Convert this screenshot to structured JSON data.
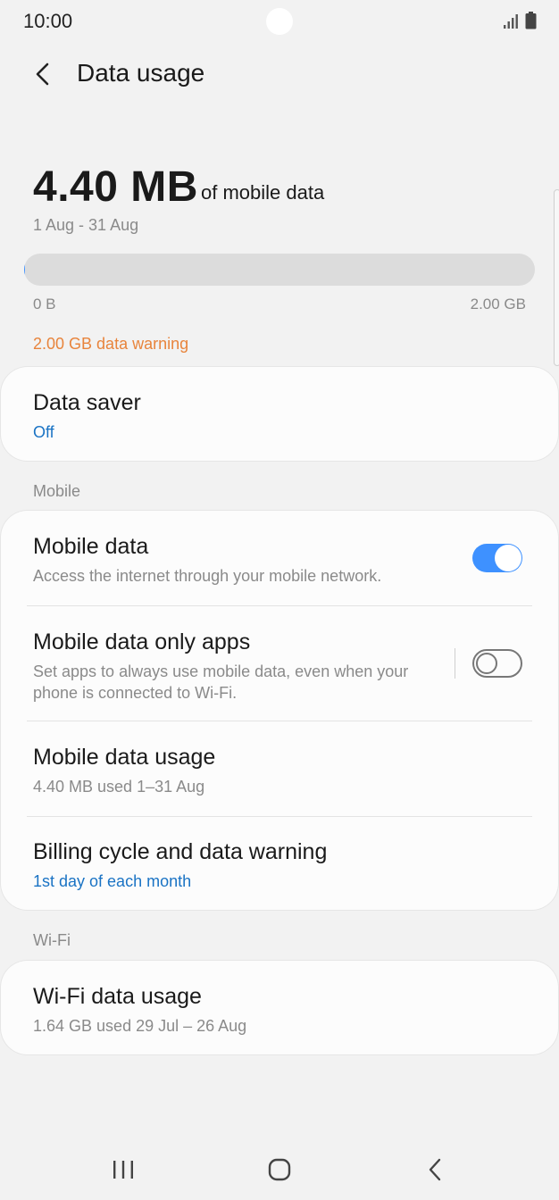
{
  "status_bar": {
    "time": "10:00"
  },
  "header": {
    "title": "Data usage"
  },
  "summary": {
    "amount": "4.40 MB",
    "unit_label": "of mobile data",
    "period": "1 Aug - 31 Aug",
    "bar_min": "0 B",
    "bar_max": "2.00 GB",
    "usage_fraction": 0.002,
    "warning": "2.00 GB data warning"
  },
  "data_saver": {
    "title": "Data saver",
    "status": "Off"
  },
  "sections": {
    "mobile": "Mobile",
    "wifi": "Wi-Fi"
  },
  "mobile": {
    "mobile_data": {
      "title": "Mobile data",
      "subtitle": "Access the internet through your mobile network.",
      "enabled": true
    },
    "only_apps": {
      "title": "Mobile data only apps",
      "subtitle": "Set apps to always use mobile data, even when your phone is connected to Wi-Fi.",
      "enabled": false
    },
    "usage": {
      "title": "Mobile data usage",
      "subtitle": "4.40 MB used 1–31 Aug"
    },
    "billing": {
      "title": "Billing cycle and data warning",
      "subtitle": "1st day of each month"
    }
  },
  "wifi": {
    "usage": {
      "title": "Wi-Fi data usage",
      "subtitle": "1.64 GB used 29 Jul – 26 Aug"
    }
  },
  "colors": {
    "accent": "#3e91ff",
    "link": "#1a73c4",
    "warning": "#e8843c",
    "background": "#f2f2f2"
  },
  "icons": {
    "back": "chevron-left-icon",
    "signal": "signal-icon",
    "battery": "battery-icon",
    "nav_recents": "recents-icon",
    "nav_home": "home-icon",
    "nav_back": "back-nav-icon"
  }
}
